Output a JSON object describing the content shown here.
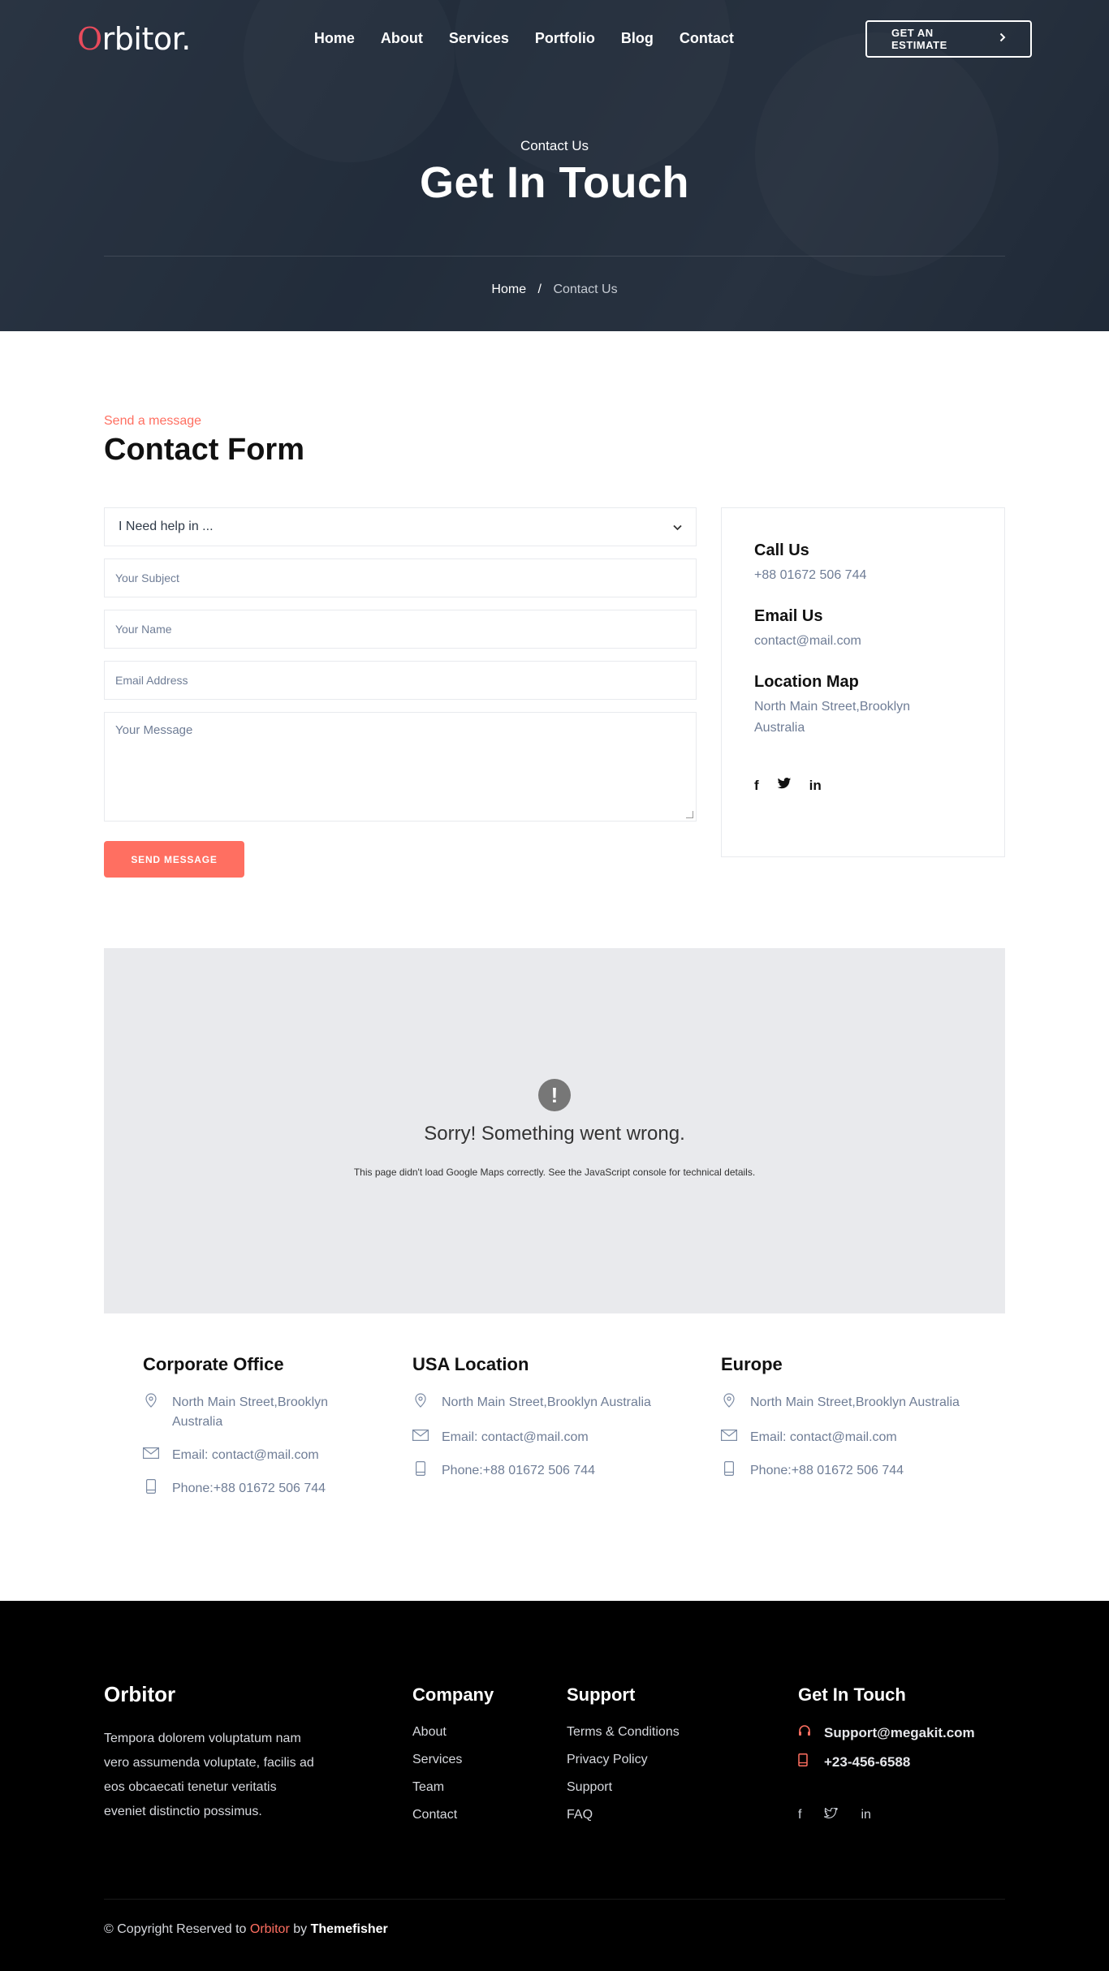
{
  "header": {
    "logo_first": "O",
    "logo_rest": "rbitor.",
    "nav": [
      "Home",
      "About",
      "Services",
      "Portfolio",
      "Blog",
      "Contact"
    ],
    "cta_label": "GET AN ESTIMATE",
    "cta_icon": "chevron-right-icon"
  },
  "hero": {
    "subtitle": "Contact Us",
    "title": "Get In Touch",
    "breadcrumb_home": "Home",
    "breadcrumb_sep": "/",
    "breadcrumb_current": "Contact Us"
  },
  "contact_form": {
    "kicker": "Send a message",
    "title": "Contact Form",
    "select_value": "I Need help in ...",
    "subject_placeholder": "Your Subject",
    "name_placeholder": "Your Name",
    "email_placeholder": "Email Address",
    "message_placeholder": "Your Message",
    "submit_label": "SEND MESSAGE"
  },
  "contact_info": {
    "call_heading": "Call Us",
    "call_value": "+88 01672 506 744",
    "email_heading": "Email Us",
    "email_value": "contact@mail.com",
    "location_heading": "Location Map",
    "location_value": "North Main Street,Brooklyn Australia",
    "socials": [
      "facebook-icon",
      "twitter-icon",
      "linkedin-icon"
    ]
  },
  "map_error": {
    "icon": "!",
    "title": "Sorry! Something went wrong.",
    "detail": "This page didn't load Google Maps correctly. See the JavaScript console for technical details."
  },
  "offices": [
    {
      "title": "Corporate Office",
      "address": "North Main Street,Brooklyn Australia",
      "email": "Email: contact@mail.com",
      "phone": "Phone:+88 01672 506 744"
    },
    {
      "title": "USA Location",
      "address": "North Main Street,Brooklyn Australia",
      "email": "Email: contact@mail.com",
      "phone": "Phone:+88 01672 506 744"
    },
    {
      "title": "Europe",
      "address": "North Main Street,Brooklyn Australia",
      "email": "Email: contact@mail.com",
      "phone": "Phone:+88 01672 506 744"
    }
  ],
  "footer": {
    "brand": "Orbitor",
    "description": "Tempora dolorem voluptatum nam vero assumenda voluptate, facilis ad eos obcaecati tenetur veritatis eveniet distinctio possimus.",
    "company_heading": "Company",
    "company_links": [
      "About",
      "Services",
      "Team",
      "Contact"
    ],
    "support_heading": "Support",
    "support_links": [
      "Terms & Conditions",
      "Privacy Policy",
      "Support",
      "FAQ"
    ],
    "touch_heading": "Get In Touch",
    "support_email": "Support@megakit.com",
    "phone": "+23-456-6588",
    "socials": [
      "facebook-icon",
      "twitter-icon",
      "linkedin-icon"
    ],
    "copyright_prefix": "© Copyright Reserved to",
    "copyright_brand": "Orbitor",
    "copyright_by": "by",
    "copyright_author": "Themefisher"
  },
  "colors": {
    "accent": "#ff6f61",
    "logo_o": "#e84b5c",
    "text_muted": "#6f7d96",
    "heading": "#111111",
    "footer_bg": "#000000",
    "map_bg": "#e9eaed"
  }
}
